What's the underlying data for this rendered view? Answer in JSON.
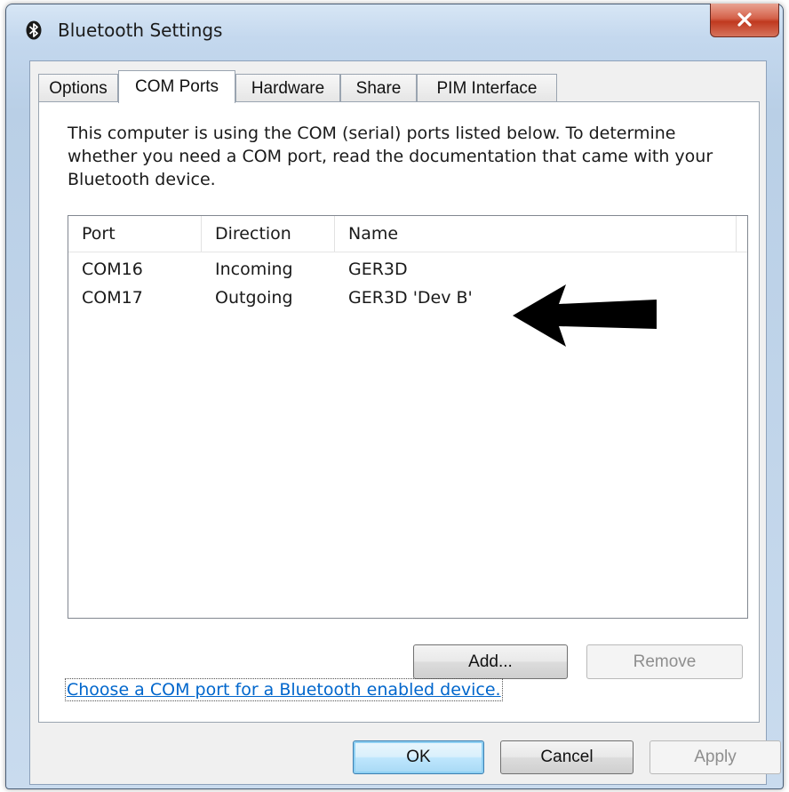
{
  "window": {
    "title": "Bluetooth Settings",
    "close_label": "Close"
  },
  "tabs": [
    {
      "label": "Options"
    },
    {
      "label": "COM Ports"
    },
    {
      "label": "Hardware"
    },
    {
      "label": "Share"
    },
    {
      "label": "PIM Interface"
    }
  ],
  "active_tab": "COM Ports",
  "panel": {
    "description": "This computer is using the COM (serial) ports listed below. To determine whether you need a COM port, read the documentation that came with your Bluetooth device."
  },
  "ports_list": {
    "columns": [
      "Port",
      "Direction",
      "Name"
    ],
    "rows": [
      {
        "port": "COM16",
        "direction": "Incoming",
        "name": "GER3D"
      },
      {
        "port": "COM17",
        "direction": "Outgoing",
        "name": "GER3D 'Dev B'"
      }
    ]
  },
  "list_buttons": {
    "add": "Add...",
    "remove": "Remove",
    "remove_enabled": false
  },
  "link": {
    "text": "Choose a COM port for a Bluetooth enabled device."
  },
  "footer": {
    "ok": "OK",
    "cancel": "Cancel",
    "apply": "Apply",
    "apply_enabled": false
  },
  "icons": {
    "title_icon": "bluetooth-icon",
    "annotation": "black-arrow-left"
  },
  "colors": {
    "link": "#0066cc",
    "close_button": "#c0391f",
    "title_bar": "#c4d8ee"
  }
}
